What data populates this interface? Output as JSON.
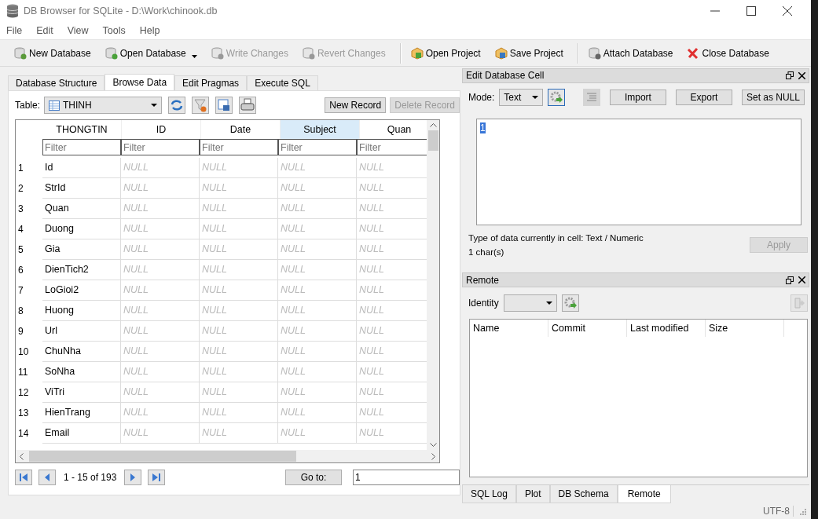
{
  "window": {
    "title": "DB Browser for SQLite - D:\\Work\\chinook.db"
  },
  "menu": [
    "File",
    "Edit",
    "View",
    "Tools",
    "Help"
  ],
  "toolbar": [
    {
      "label": "New Database",
      "disabled": false,
      "dropdown": false
    },
    {
      "label": "Open Database",
      "disabled": false,
      "dropdown": true
    },
    {
      "label": "Write Changes",
      "disabled": true,
      "dropdown": false
    },
    {
      "label": "Revert Changes",
      "disabled": true,
      "dropdown": false
    },
    {
      "label": "Open Project",
      "disabled": false,
      "dropdown": false
    },
    {
      "label": "Save Project",
      "disabled": false,
      "dropdown": false
    },
    {
      "label": "Attach Database",
      "disabled": false,
      "dropdown": false
    },
    {
      "label": "Close Database",
      "disabled": false,
      "dropdown": false
    }
  ],
  "tabs": [
    {
      "label": "Database Structure",
      "selected": false
    },
    {
      "label": "Browse Data",
      "selected": true
    },
    {
      "label": "Edit Pragmas",
      "selected": false
    },
    {
      "label": "Execute SQL",
      "selected": false
    }
  ],
  "browse": {
    "table_label": "Table:",
    "table_value": "THINH",
    "new_record": "New Record",
    "delete_record": "Delete Record",
    "delete_disabled": true,
    "columns": [
      {
        "label": "THONGTIN",
        "selected": false,
        "filter_placeholder": "Filter"
      },
      {
        "label": "ID",
        "selected": false,
        "filter_placeholder": "Filter"
      },
      {
        "label": "Date",
        "selected": false,
        "filter_placeholder": "Filter"
      },
      {
        "label": "Subject",
        "selected": true,
        "filter_placeholder": "Filter"
      },
      {
        "label": "Quan",
        "selected": false,
        "filter_placeholder": "Filter"
      }
    ],
    "rows": [
      {
        "number": "1",
        "cells": [
          "Id",
          "NULL",
          "NULL",
          "NULL",
          "NULL"
        ]
      },
      {
        "number": "2",
        "cells": [
          "StrId",
          "NULL",
          "NULL",
          "NULL",
          "NULL"
        ]
      },
      {
        "number": "3",
        "cells": [
          "Quan",
          "NULL",
          "NULL",
          "NULL",
          "NULL"
        ]
      },
      {
        "number": "4",
        "cells": [
          "Duong",
          "NULL",
          "NULL",
          "NULL",
          "NULL"
        ]
      },
      {
        "number": "5",
        "cells": [
          "Gia",
          "NULL",
          "NULL",
          "NULL",
          "NULL"
        ]
      },
      {
        "number": "6",
        "cells": [
          "DienTich2",
          "NULL",
          "NULL",
          "NULL",
          "NULL"
        ]
      },
      {
        "number": "7",
        "cells": [
          "LoGioi2",
          "NULL",
          "NULL",
          "NULL",
          "NULL"
        ]
      },
      {
        "number": "8",
        "cells": [
          "Huong",
          "NULL",
          "NULL",
          "NULL",
          "NULL"
        ]
      },
      {
        "number": "9",
        "cells": [
          "Url",
          "NULL",
          "NULL",
          "NULL",
          "NULL"
        ]
      },
      {
        "number": "10",
        "cells": [
          "ChuNha",
          "NULL",
          "NULL",
          "NULL",
          "NULL"
        ]
      },
      {
        "number": "11",
        "cells": [
          "SoNha",
          "NULL",
          "NULL",
          "NULL",
          "NULL"
        ]
      },
      {
        "number": "12",
        "cells": [
          "ViTri",
          "NULL",
          "NULL",
          "NULL",
          "NULL"
        ]
      },
      {
        "number": "13",
        "cells": [
          "HienTrang",
          "NULL",
          "NULL",
          "NULL",
          "NULL"
        ]
      },
      {
        "number": "14",
        "cells": [
          "Email",
          "NULL",
          "NULL",
          "NULL",
          "NULL"
        ]
      }
    ],
    "page_info": "1 - 15 of 193",
    "goto_label": "Go to:",
    "goto_value": "1"
  },
  "edit_cell": {
    "title": "Edit Database Cell",
    "mode_label": "Mode:",
    "mode_value": "Text",
    "buttons": [
      "Import",
      "Export",
      "Set as NULL"
    ],
    "value": "1",
    "type_info": "Type of data currently in cell: Text / Numeric",
    "size_info": "1 char(s)",
    "apply": "Apply",
    "apply_disabled": true
  },
  "remote": {
    "title": "Remote",
    "identity_label": "Identity",
    "columns": [
      "Name",
      "Commit",
      "Last modified",
      "Size"
    ]
  },
  "dock_tabs": [
    {
      "label": "SQL Log",
      "selected": false
    },
    {
      "label": "Plot",
      "selected": false
    },
    {
      "label": "DB Schema",
      "selected": false
    },
    {
      "label": "Remote",
      "selected": true
    }
  ],
  "status_bar": {
    "encoding": "UTF-8"
  }
}
